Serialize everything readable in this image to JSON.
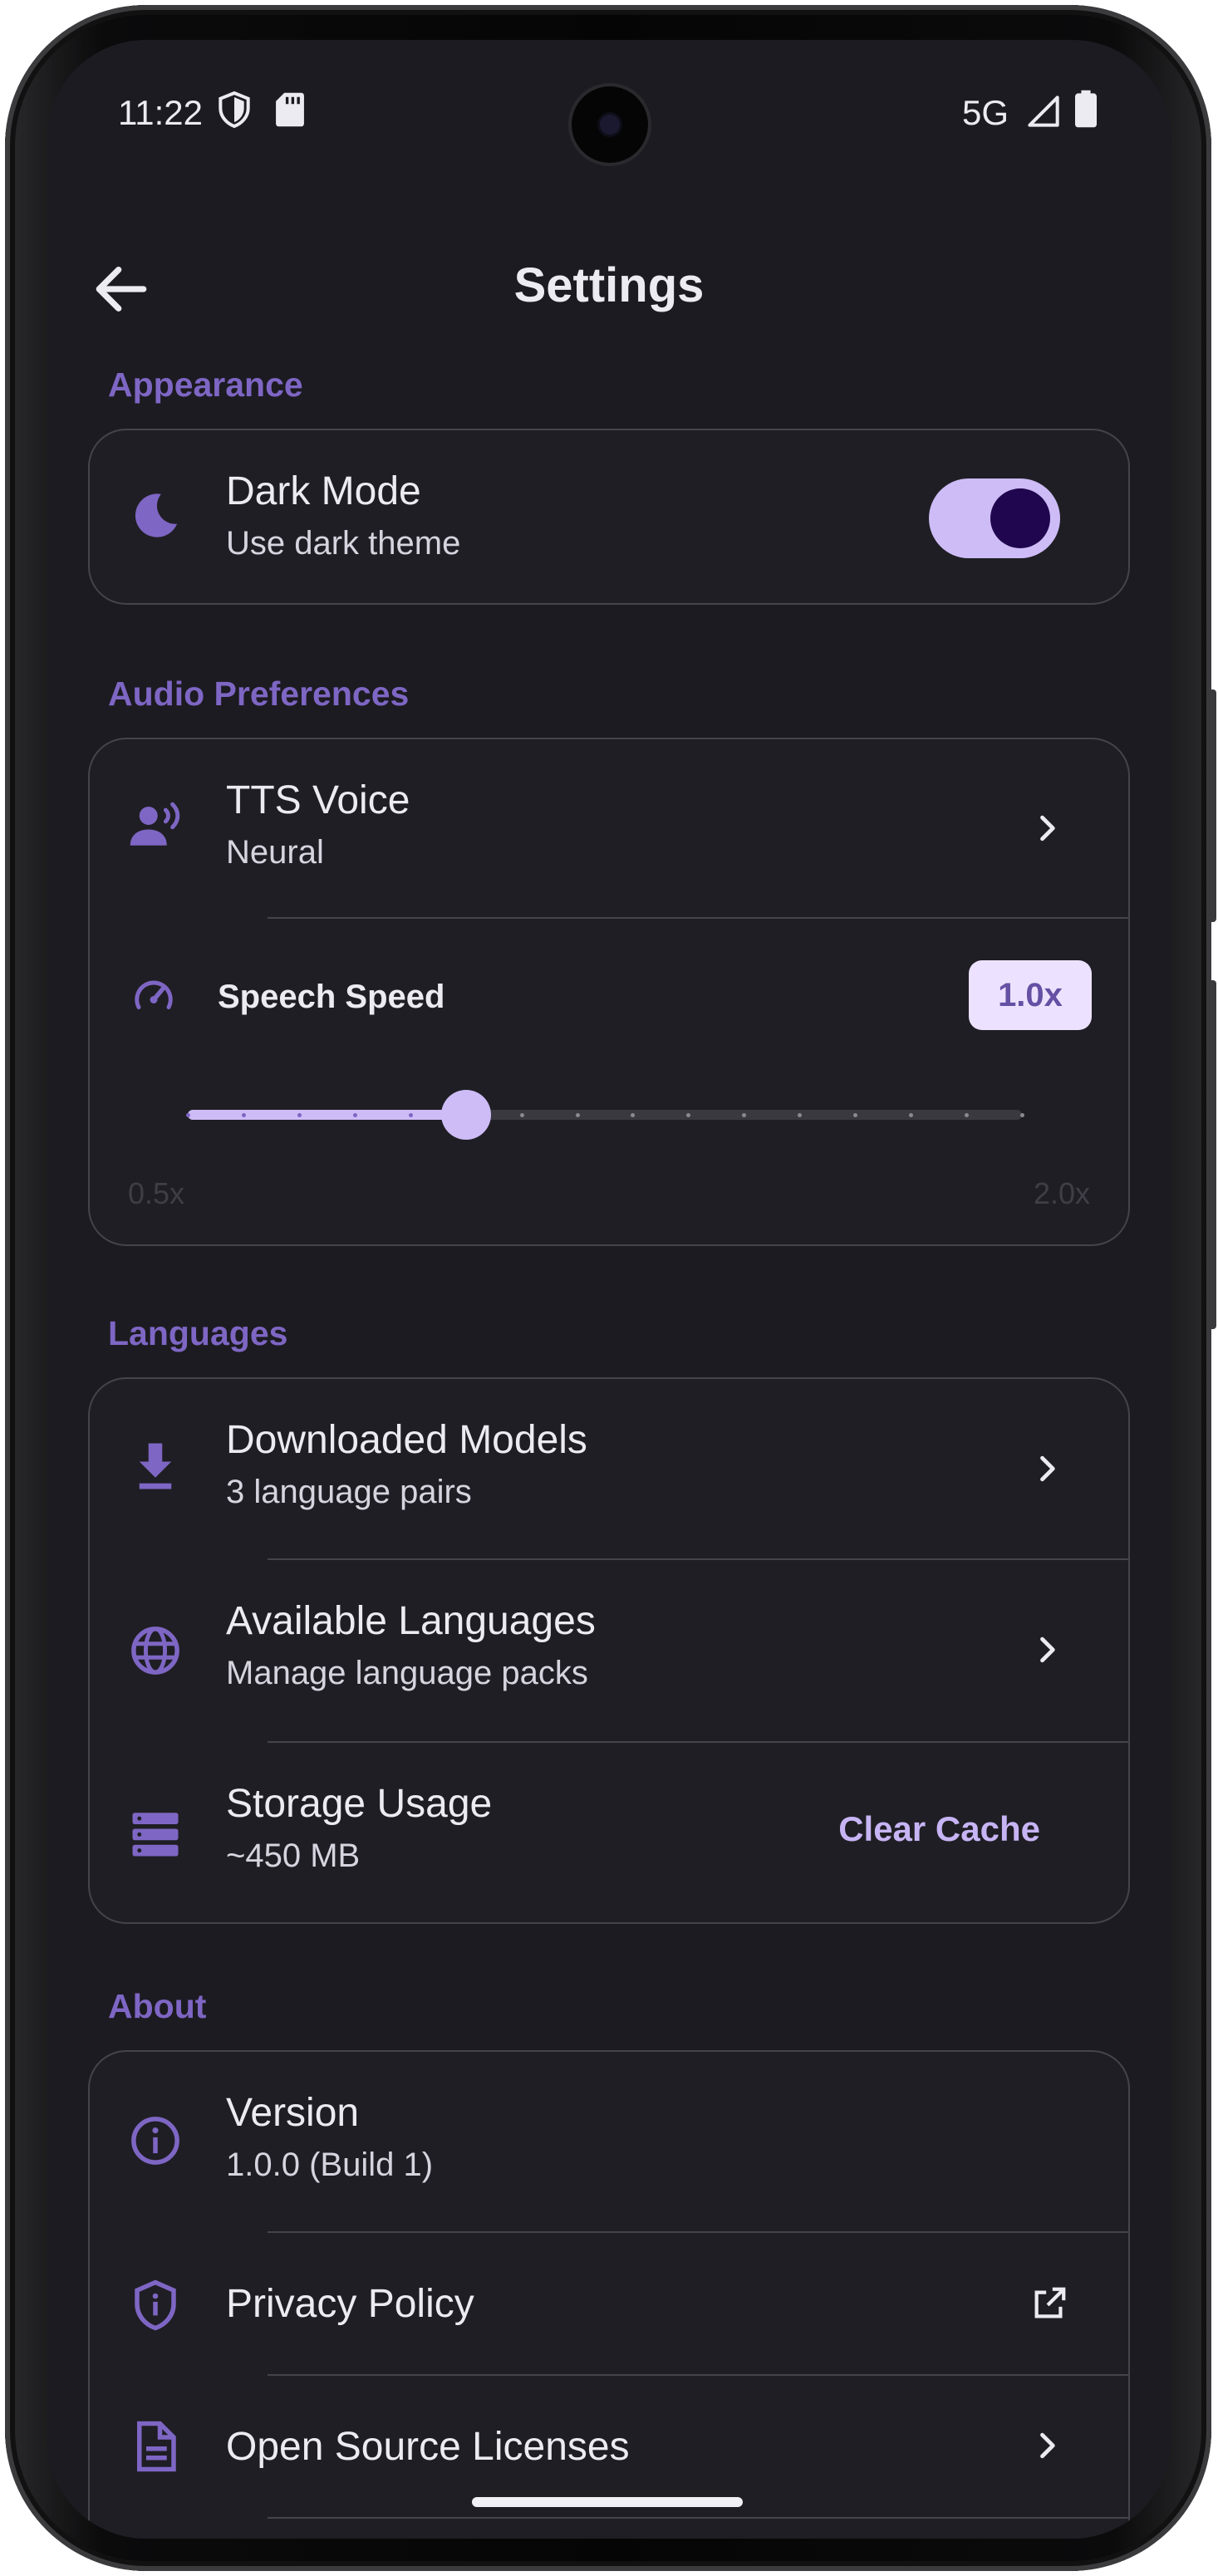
{
  "status_bar": {
    "time": "11:22",
    "network": "5G"
  },
  "app_bar": {
    "title": "Settings"
  },
  "sections": {
    "appearance": {
      "label": "Appearance",
      "dark_mode": {
        "title": "Dark Mode",
        "subtitle": "Use dark theme",
        "enabled": true
      }
    },
    "audio": {
      "label": "Audio Preferences",
      "tts_voice": {
        "title": "TTS Voice",
        "subtitle": "Neural"
      },
      "speech_speed": {
        "label": "Speech Speed",
        "value_label": "1.0x",
        "value": 1.0,
        "min": 0.5,
        "max": 2.0,
        "min_label": "0.5x",
        "max_label": "2.0x",
        "steps": 15
      }
    },
    "languages": {
      "label": "Languages",
      "downloaded_models": {
        "title": "Downloaded Models",
        "subtitle": "3 language pairs"
      },
      "available_languages": {
        "title": "Available Languages",
        "subtitle": "Manage language packs"
      },
      "storage_usage": {
        "title": "Storage Usage",
        "subtitle": "~450 MB",
        "action_label": "Clear Cache"
      }
    },
    "about": {
      "label": "About",
      "version": {
        "title": "Version",
        "subtitle": "1.0.0 (Build 1)"
      },
      "privacy_policy": {
        "title": "Privacy Policy"
      },
      "licenses": {
        "title": "Open Source Licenses"
      }
    }
  },
  "colors": {
    "background": "#1c1b21",
    "accent": "#7e66c4",
    "toggle_track": "#cdbcf6",
    "toggle_knob": "#20064e"
  },
  "icons": {
    "back": "arrow-left-icon",
    "dark_mode": "moon-icon",
    "tts_voice": "voice-icon",
    "speech_speed": "speedometer-icon",
    "downloaded_models": "download-icon",
    "available_languages": "globe-icon",
    "storage_usage": "storage-icon",
    "version": "info-icon",
    "privacy_policy": "shield-icon",
    "licenses": "document-icon"
  }
}
